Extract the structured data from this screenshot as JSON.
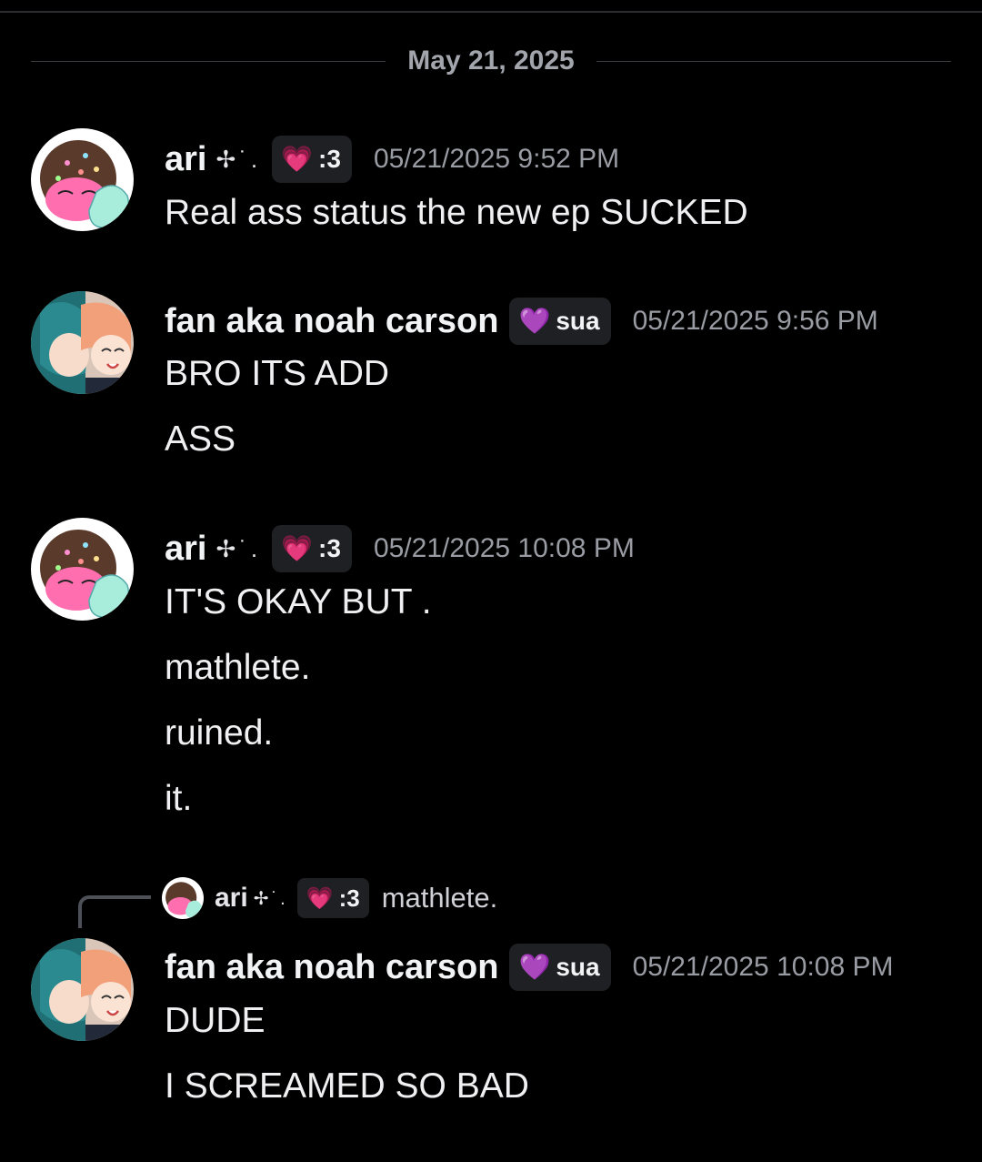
{
  "divider": {
    "date": "May 21, 2025"
  },
  "messages": [
    {
      "username": "ari",
      "sparkle": "✢˙.",
      "tag": {
        "heart": "💗",
        "label": ":3",
        "heart_color": "#ff9ec8"
      },
      "timestamp": "05/21/2025 9:52 PM",
      "lines": [
        "Real ass status the new ep SUCKED"
      ]
    },
    {
      "username": "fan aka noah carson",
      "tag": {
        "heart": "💜",
        "label": "sua",
        "heart_color": "#c9a7f5"
      },
      "timestamp": "05/21/2025 9:56 PM",
      "lines": [
        "BRO ITS ADD",
        "ASS"
      ]
    },
    {
      "username": "ari",
      "sparkle": "✢˙.",
      "tag": {
        "heart": "💗",
        "label": ":3",
        "heart_color": "#ff9ec8"
      },
      "timestamp": "05/21/2025 10:08 PM",
      "lines": [
        "IT'S OKAY BUT .",
        "mathlete.",
        "ruined.",
        "it."
      ]
    },
    {
      "reply": {
        "username": "ari",
        "sparkle": "✢˙.",
        "tag_label": ":3",
        "tag_heart": "💗",
        "text": "mathlete."
      },
      "username": "fan aka noah carson",
      "tag": {
        "heart": "💜",
        "label": "sua",
        "heart_color": "#c9a7f5"
      },
      "timestamp": "05/21/2025 10:08 PM",
      "lines": [
        "DUDE",
        "I SCREAMED SO BAD"
      ]
    }
  ],
  "avatars": {
    "ari": "ari-avatar",
    "fan": "fan-avatar"
  }
}
